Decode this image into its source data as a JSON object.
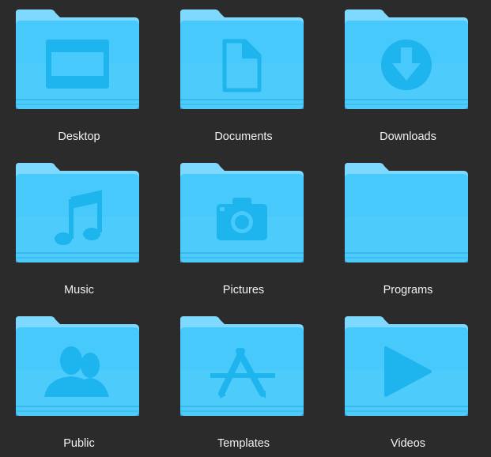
{
  "folders": [
    {
      "label": "Desktop",
      "icon": "desktop-icon"
    },
    {
      "label": "Documents",
      "icon": "document-icon"
    },
    {
      "label": "Downloads",
      "icon": "download-icon"
    },
    {
      "label": "Music",
      "icon": "music-note-icon"
    },
    {
      "label": "Pictures",
      "icon": "camera-icon"
    },
    {
      "label": "Programs",
      "icon": "none"
    },
    {
      "label": "Public",
      "icon": "users-icon"
    },
    {
      "label": "Templates",
      "icon": "app-store-icon"
    },
    {
      "label": "Videos",
      "icon": "play-icon"
    }
  ],
  "colors": {
    "background": "#2b2b2b",
    "folder_top": "#46c8fb",
    "folder_bottom": "#5bd4ff",
    "folder_tab": "#7fd9ff",
    "glyph": "#1eb4ee",
    "label": "#f2f2f2"
  }
}
